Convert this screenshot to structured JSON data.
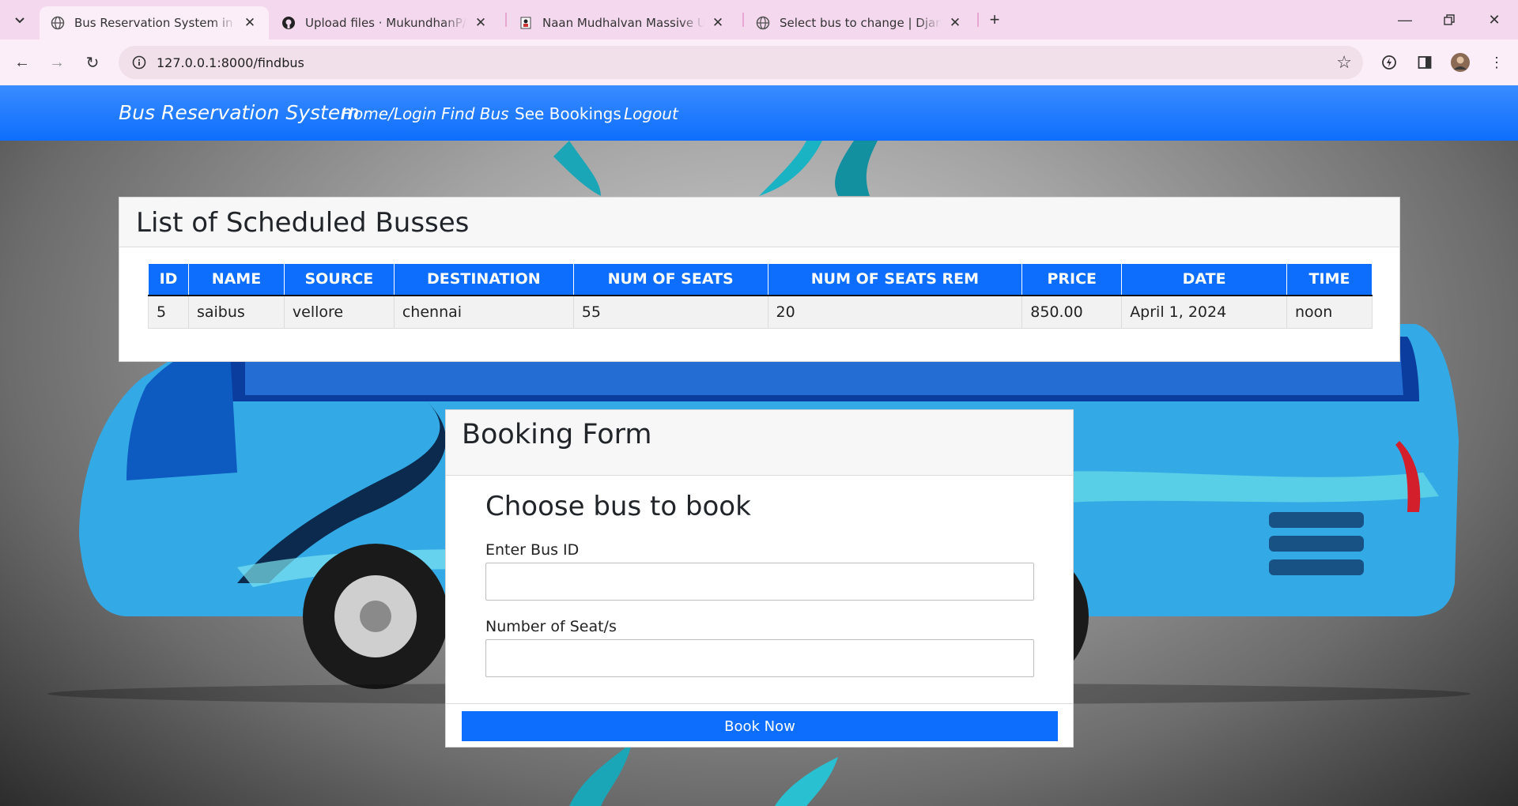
{
  "browser": {
    "tabs": [
      {
        "title": "Bus Reservation System in Djan",
        "icon": "globe-icon"
      },
      {
        "title": "Upload files · MukundhanP/Naa",
        "icon": "github-icon"
      },
      {
        "title": "Naan Mudhalvan Massive Upsk",
        "icon": "naan-mudhalvan-icon"
      },
      {
        "title": "Select bus to change | Django s",
        "icon": "globe-icon"
      }
    ],
    "url": "127.0.0.1:8000/findbus"
  },
  "navbar": {
    "brand": "Bus Reservation System",
    "links": [
      "Home/Login",
      "Find Bus",
      "See Bookings",
      "Logout"
    ]
  },
  "scheduled": {
    "title": "List of Scheduled Busses",
    "columns": [
      "ID",
      "NAME",
      "SOURCE",
      "DESTINATION",
      "NUM OF SEATS",
      "NUM OF SEATS REM",
      "PRICE",
      "DATE",
      "TIME"
    ],
    "rows": [
      [
        "5",
        "saibus",
        "vellore",
        "chennai",
        "55",
        "20",
        "850.00",
        "April 1, 2024",
        "noon"
      ]
    ]
  },
  "booking": {
    "title": "Booking Form",
    "subtitle": "Choose bus to book",
    "bus_id_label": "Enter Bus ID",
    "bus_id_value": "",
    "seats_label": "Number of Seat/s",
    "seats_value": "",
    "submit_label": "Book Now"
  },
  "colors": {
    "primary": "#0d6efd",
    "tabstrip": "#f4d9ee",
    "toolbar": "#fbeef8"
  }
}
